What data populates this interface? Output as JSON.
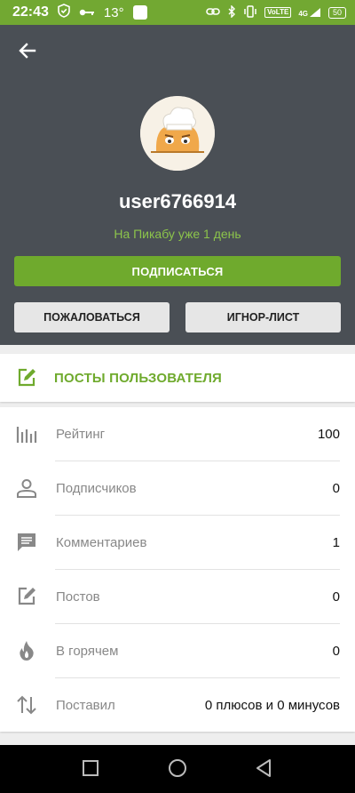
{
  "status_bar": {
    "time": "22:43",
    "temperature": "13°",
    "volte": "VoLTE",
    "network": "4G",
    "battery": "50"
  },
  "profile": {
    "username": "user6766914",
    "since": "На Пикабу уже 1 день",
    "subscribe_label": "ПОДПИСАТЬСЯ",
    "report_label": "ПОЖАЛОВАТЬСЯ",
    "ignore_label": "ИГНОР-ЛИСТ"
  },
  "posts": {
    "label": "ПОСТЫ ПОЛЬЗОВАТЕЛЯ",
    "icon": "edit-icon"
  },
  "stats": [
    {
      "icon": "bar-chart-icon",
      "label": "Рейтинг",
      "value": "100"
    },
    {
      "icon": "person-icon",
      "label": "Подписчиков",
      "value": "0"
    },
    {
      "icon": "comment-icon",
      "label": "Комментариев",
      "value": "1"
    },
    {
      "icon": "edit-icon",
      "label": "Постов",
      "value": "0"
    },
    {
      "icon": "flame-icon",
      "label": "В горячем",
      "value": "0"
    },
    {
      "icon": "swap-vertical-icon",
      "label": "Поставил",
      "value": "0 плюсов и 0 минусов"
    }
  ],
  "colors": {
    "accent": "#6faa2d",
    "header_bg": "#4a4f55",
    "status_bar": "#72a832"
  }
}
